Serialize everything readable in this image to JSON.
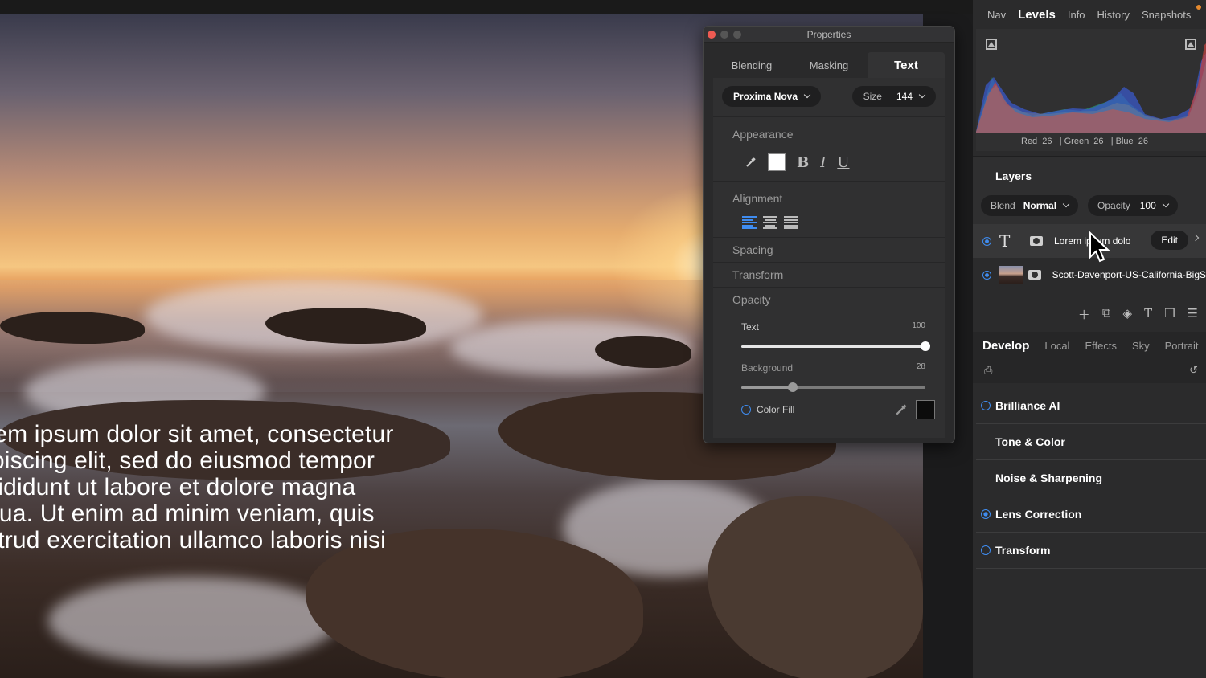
{
  "canvas": {
    "overlay_text": "rem ipsum dolor sit amet, consectetur\nipiscing elit, sed do eiusmod tempor\ncididunt ut labore et dolore magna\nqua. Ut enim ad minim veniam, quis\nstrud exercitation ullamco laboris nisi"
  },
  "properties": {
    "title": "Properties",
    "tabs": [
      {
        "label": "Blending",
        "active": false
      },
      {
        "label": "Masking",
        "active": false
      },
      {
        "label": "Text",
        "active": true
      }
    ],
    "font": {
      "name": "Proxima Nova"
    },
    "size": {
      "label": "Size",
      "value": "144"
    },
    "sections": {
      "appearance": "Appearance",
      "alignment": "Alignment",
      "spacing": "Spacing",
      "transform": "Transform",
      "opacity": "Opacity"
    },
    "appearance": {
      "color": "#ffffff",
      "bold": "B",
      "italic": "I",
      "underline": "U"
    },
    "opacity": {
      "text_label": "Text",
      "text_value": "100",
      "text_fraction": 1.0,
      "background_label": "Background",
      "background_value": "28",
      "background_fraction": 0.28
    },
    "color_fill": {
      "label": "Color Fill",
      "color": "#0c0c0c"
    }
  },
  "sidebar": {
    "nav_tabs": [
      {
        "label": "Nav",
        "active": false
      },
      {
        "label": "Levels",
        "active": true
      },
      {
        "label": "Info",
        "active": false
      },
      {
        "label": "History",
        "active": false
      },
      {
        "label": "Snapshots",
        "active": false
      }
    ],
    "rgb_readout": "Red  26   | Green  26   | Blue  26",
    "layers": {
      "title": "Layers",
      "blend_label": "Blend",
      "blend_value": "Normal",
      "opacity_label": "Opacity",
      "opacity_value": "100",
      "items": [
        {
          "name": "Lorem ipsum dolo",
          "type": "text",
          "edit_label": "Edit"
        },
        {
          "name": "Scott-Davenport-US-California-BigS",
          "type": "image"
        }
      ]
    },
    "develop_tabs": [
      {
        "label": "Develop",
        "active": true
      },
      {
        "label": "Local",
        "active": false
      },
      {
        "label": "Effects",
        "active": false
      },
      {
        "label": "Sky",
        "active": false
      },
      {
        "label": "Portrait",
        "active": false
      }
    ],
    "develop_sections": [
      {
        "label": "Brilliance AI",
        "radio": "off"
      },
      {
        "label": "Tone & Color",
        "radio": "none"
      },
      {
        "label": "Noise & Sharpening",
        "radio": "none"
      },
      {
        "label": "Lens Correction",
        "radio": "on"
      },
      {
        "label": "Transform",
        "radio": "off"
      }
    ]
  },
  "colors": {
    "accent": "#3f8cf0",
    "notification": "#e58a2e"
  }
}
